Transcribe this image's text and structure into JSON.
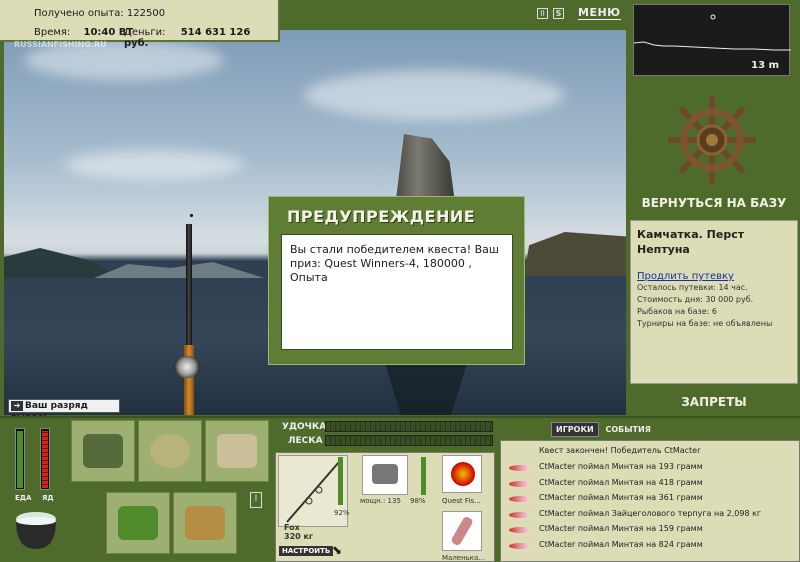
{
  "info": {
    "exp_label": "Получено опыта:",
    "exp_value": "122500",
    "time_label": "Время:",
    "time_value": "10:40 ВТ",
    "money_label": "Деньги:",
    "money_value": "514 631 126 руб.",
    "logo": "RUSSIANFISHING.RU"
  },
  "topbar": {
    "pause": "II",
    "sound": "S",
    "menu": "МЕНЮ"
  },
  "depth": {
    "label": "13 m"
  },
  "right": {
    "return_base": "ВЕРНУТЬСЯ НА БАЗУ",
    "location": "Камчатка. Перст Нептуна",
    "extend_link": "Продлить путевку",
    "lines": [
      "Осталось путевки: 14 час.",
      "Стоимость дня: 30 000 руб.",
      "Рыбаков на базе: 6",
      "Турниры на базе: не объявлены"
    ],
    "bans": "ЗАПРЕТЫ"
  },
  "dialog": {
    "title": "ПРЕДУПРЕЖДЕНИЕ",
    "text": "Вы стали победителем квеста! Ваш приз: Quest Winners-4, 180000 , Опыта"
  },
  "rank": {
    "text": "Ваш разряд вырос!"
  },
  "meters": {
    "food_label": "ЕДА",
    "food_level": 0.95,
    "food_color": "#4c8c2a",
    "poison_label": "ЯД",
    "poison_level": 0.95,
    "poison_color": "#c7271d"
  },
  "tackle": {
    "rod_label": "УДОЧКА",
    "line_label": "ЛЕСКА",
    "rod_name": "Fox",
    "rod_weight": "320 кг",
    "rod_pct": "92%",
    "reel_power": "мощн.: 135",
    "reel_pct": "98%",
    "lure_name": "Quest Fis...",
    "bait_name": "Маленька...",
    "setup_button": "НАСТРОИТЬ"
  },
  "events": {
    "tab_players": "ИГРОКИ",
    "tab_events": "СОБЫТИЯ",
    "items": [
      "Квест закончен! Победитель CtMacter",
      "CtMacter поймал Минтая на 193 грамм",
      "CtMacter поймал Минтая на 418 грамм",
      "CtMacter поймал Минтая на 361 грамм",
      "CtMacter поймал Зайцеголового терпуга на 2,098 кг",
      "CtMacter поймал Минтая на 159 грамм",
      "CtMacter поймал Минтая на 824 грамм"
    ]
  },
  "inventory": {
    "scroll_button": "I"
  }
}
